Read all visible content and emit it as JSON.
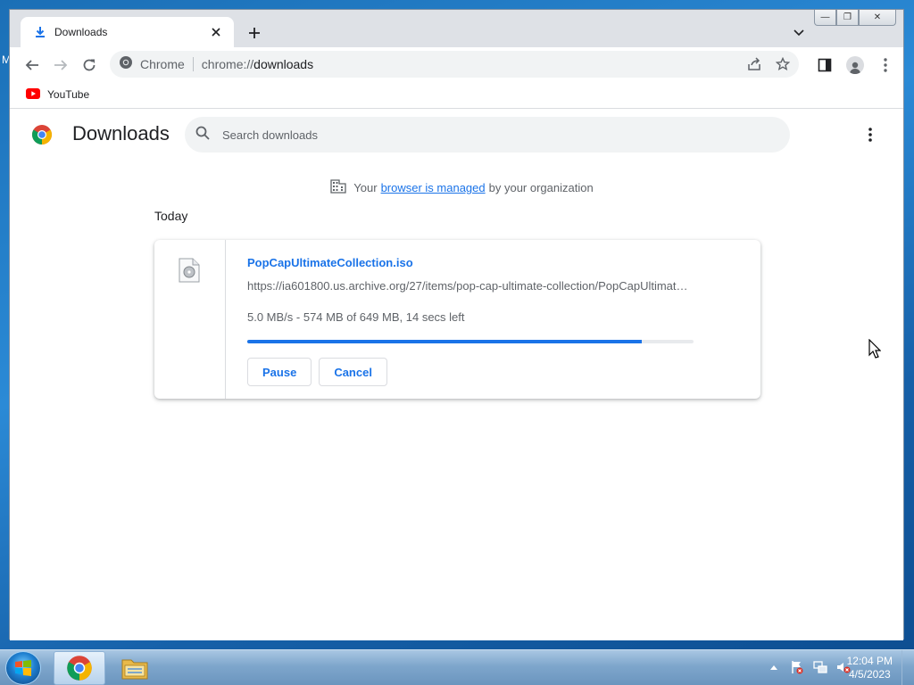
{
  "desktop": {
    "edge_text_left": "M"
  },
  "window": {
    "tab": {
      "title": "Downloads"
    },
    "controls": {
      "minimize": "—",
      "restore": "❐",
      "close": "✕"
    }
  },
  "omnibox": {
    "site_label": "Chrome",
    "url_scheme": "chrome://",
    "url_host": "downloads"
  },
  "bookmarks": [
    {
      "label": "YouTube"
    }
  ],
  "page": {
    "title": "Downloads",
    "search": {
      "placeholder": "Search downloads",
      "value": ""
    },
    "managed": {
      "prefix": "Your",
      "link": "browser is managed",
      "suffix": "by your organization"
    },
    "day_label": "Today"
  },
  "download": {
    "file_name": "PopCapUltimateCollection.iso",
    "url": "https://ia601800.us.archive.org/27/items/pop-cap-ultimate-collection/PopCapUltimateCollection.iso",
    "status": "5.0 MB/s - 574 MB of 649 MB, 14 secs left",
    "progress": 0.884,
    "pause_label": "Pause",
    "cancel_label": "Cancel"
  },
  "taskbar": {
    "time": "12:04 PM",
    "date": "4/5/2023"
  },
  "colors": {
    "accent": "#1a73e8",
    "tab_strip": "#dee1e6",
    "taskbar": "#7ea6cc"
  },
  "icons": [
    "download-icon",
    "close-icon",
    "plus-icon",
    "chevron-down-icon",
    "back-icon",
    "forward-icon",
    "reload-icon",
    "chrome-icon",
    "share-icon",
    "star-icon",
    "side-panel-icon",
    "profile-icon",
    "kebab-icon",
    "youtube-icon",
    "search-icon",
    "building-icon",
    "file-icon",
    "cursor-icon",
    "windows-start-icon",
    "chrome-taskbar-icon",
    "explorer-icon",
    "tray-arrow-icon",
    "flag-icon",
    "network-icon",
    "volume-muted-icon"
  ]
}
